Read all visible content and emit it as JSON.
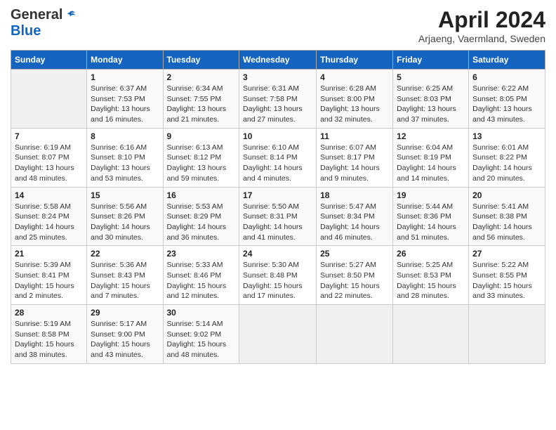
{
  "header": {
    "logo_general": "General",
    "logo_blue": "Blue",
    "month_title": "April 2024",
    "subtitle": "Arjaeng, Vaermland, Sweden"
  },
  "days_of_week": [
    "Sunday",
    "Monday",
    "Tuesday",
    "Wednesday",
    "Thursday",
    "Friday",
    "Saturday"
  ],
  "weeks": [
    [
      {
        "day": "",
        "info": ""
      },
      {
        "day": "1",
        "info": "Sunrise: 6:37 AM\nSunset: 7:53 PM\nDaylight: 13 hours\nand 16 minutes."
      },
      {
        "day": "2",
        "info": "Sunrise: 6:34 AM\nSunset: 7:55 PM\nDaylight: 13 hours\nand 21 minutes."
      },
      {
        "day": "3",
        "info": "Sunrise: 6:31 AM\nSunset: 7:58 PM\nDaylight: 13 hours\nand 27 minutes."
      },
      {
        "day": "4",
        "info": "Sunrise: 6:28 AM\nSunset: 8:00 PM\nDaylight: 13 hours\nand 32 minutes."
      },
      {
        "day": "5",
        "info": "Sunrise: 6:25 AM\nSunset: 8:03 PM\nDaylight: 13 hours\nand 37 minutes."
      },
      {
        "day": "6",
        "info": "Sunrise: 6:22 AM\nSunset: 8:05 PM\nDaylight: 13 hours\nand 43 minutes."
      }
    ],
    [
      {
        "day": "7",
        "info": "Sunrise: 6:19 AM\nSunset: 8:07 PM\nDaylight: 13 hours\nand 48 minutes."
      },
      {
        "day": "8",
        "info": "Sunrise: 6:16 AM\nSunset: 8:10 PM\nDaylight: 13 hours\nand 53 minutes."
      },
      {
        "day": "9",
        "info": "Sunrise: 6:13 AM\nSunset: 8:12 PM\nDaylight: 13 hours\nand 59 minutes."
      },
      {
        "day": "10",
        "info": "Sunrise: 6:10 AM\nSunset: 8:14 PM\nDaylight: 14 hours\nand 4 minutes."
      },
      {
        "day": "11",
        "info": "Sunrise: 6:07 AM\nSunset: 8:17 PM\nDaylight: 14 hours\nand 9 minutes."
      },
      {
        "day": "12",
        "info": "Sunrise: 6:04 AM\nSunset: 8:19 PM\nDaylight: 14 hours\nand 14 minutes."
      },
      {
        "day": "13",
        "info": "Sunrise: 6:01 AM\nSunset: 8:22 PM\nDaylight: 14 hours\nand 20 minutes."
      }
    ],
    [
      {
        "day": "14",
        "info": "Sunrise: 5:58 AM\nSunset: 8:24 PM\nDaylight: 14 hours\nand 25 minutes."
      },
      {
        "day": "15",
        "info": "Sunrise: 5:56 AM\nSunset: 8:26 PM\nDaylight: 14 hours\nand 30 minutes."
      },
      {
        "day": "16",
        "info": "Sunrise: 5:53 AM\nSunset: 8:29 PM\nDaylight: 14 hours\nand 36 minutes."
      },
      {
        "day": "17",
        "info": "Sunrise: 5:50 AM\nSunset: 8:31 PM\nDaylight: 14 hours\nand 41 minutes."
      },
      {
        "day": "18",
        "info": "Sunrise: 5:47 AM\nSunset: 8:34 PM\nDaylight: 14 hours\nand 46 minutes."
      },
      {
        "day": "19",
        "info": "Sunrise: 5:44 AM\nSunset: 8:36 PM\nDaylight: 14 hours\nand 51 minutes."
      },
      {
        "day": "20",
        "info": "Sunrise: 5:41 AM\nSunset: 8:38 PM\nDaylight: 14 hours\nand 56 minutes."
      }
    ],
    [
      {
        "day": "21",
        "info": "Sunrise: 5:39 AM\nSunset: 8:41 PM\nDaylight: 15 hours\nand 2 minutes."
      },
      {
        "day": "22",
        "info": "Sunrise: 5:36 AM\nSunset: 8:43 PM\nDaylight: 15 hours\nand 7 minutes."
      },
      {
        "day": "23",
        "info": "Sunrise: 5:33 AM\nSunset: 8:46 PM\nDaylight: 15 hours\nand 12 minutes."
      },
      {
        "day": "24",
        "info": "Sunrise: 5:30 AM\nSunset: 8:48 PM\nDaylight: 15 hours\nand 17 minutes."
      },
      {
        "day": "25",
        "info": "Sunrise: 5:27 AM\nSunset: 8:50 PM\nDaylight: 15 hours\nand 22 minutes."
      },
      {
        "day": "26",
        "info": "Sunrise: 5:25 AM\nSunset: 8:53 PM\nDaylight: 15 hours\nand 28 minutes."
      },
      {
        "day": "27",
        "info": "Sunrise: 5:22 AM\nSunset: 8:55 PM\nDaylight: 15 hours\nand 33 minutes."
      }
    ],
    [
      {
        "day": "28",
        "info": "Sunrise: 5:19 AM\nSunset: 8:58 PM\nDaylight: 15 hours\nand 38 minutes."
      },
      {
        "day": "29",
        "info": "Sunrise: 5:17 AM\nSunset: 9:00 PM\nDaylight: 15 hours\nand 43 minutes."
      },
      {
        "day": "30",
        "info": "Sunrise: 5:14 AM\nSunset: 9:02 PM\nDaylight: 15 hours\nand 48 minutes."
      },
      {
        "day": "",
        "info": ""
      },
      {
        "day": "",
        "info": ""
      },
      {
        "day": "",
        "info": ""
      },
      {
        "day": "",
        "info": ""
      }
    ]
  ]
}
